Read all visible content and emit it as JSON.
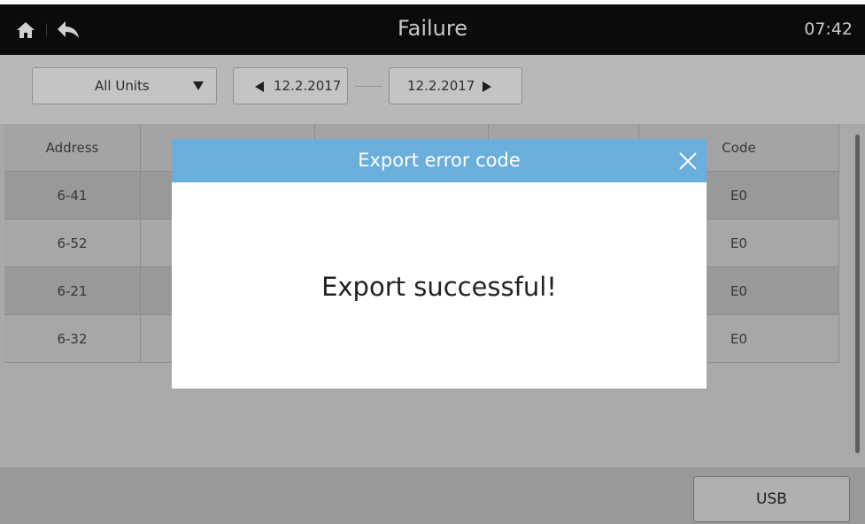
{
  "header": {
    "title": "Failure",
    "time": "07:42"
  },
  "filters": {
    "unit_select": "All Units",
    "date_start": "12.2.2017",
    "date_end": "12.2.2017"
  },
  "table": {
    "headers": [
      "Address",
      "",
      "",
      "",
      "Code"
    ],
    "rows": [
      {
        "address": "6-41",
        "code": "E0"
      },
      {
        "address": "6-52",
        "code": "E0"
      },
      {
        "address": "6-21",
        "code": "E0"
      },
      {
        "address": "6-32",
        "code": "E0"
      }
    ]
  },
  "footer": {
    "usb_label": "USB"
  },
  "modal": {
    "title": "Export error code",
    "message": "Export successful!"
  },
  "icons": {
    "home": "home-icon",
    "back": "back-arrow-icon",
    "close": "close-icon"
  },
  "colors": {
    "modal_header": "#6aaedb",
    "topbar": "#0b0b0b"
  }
}
